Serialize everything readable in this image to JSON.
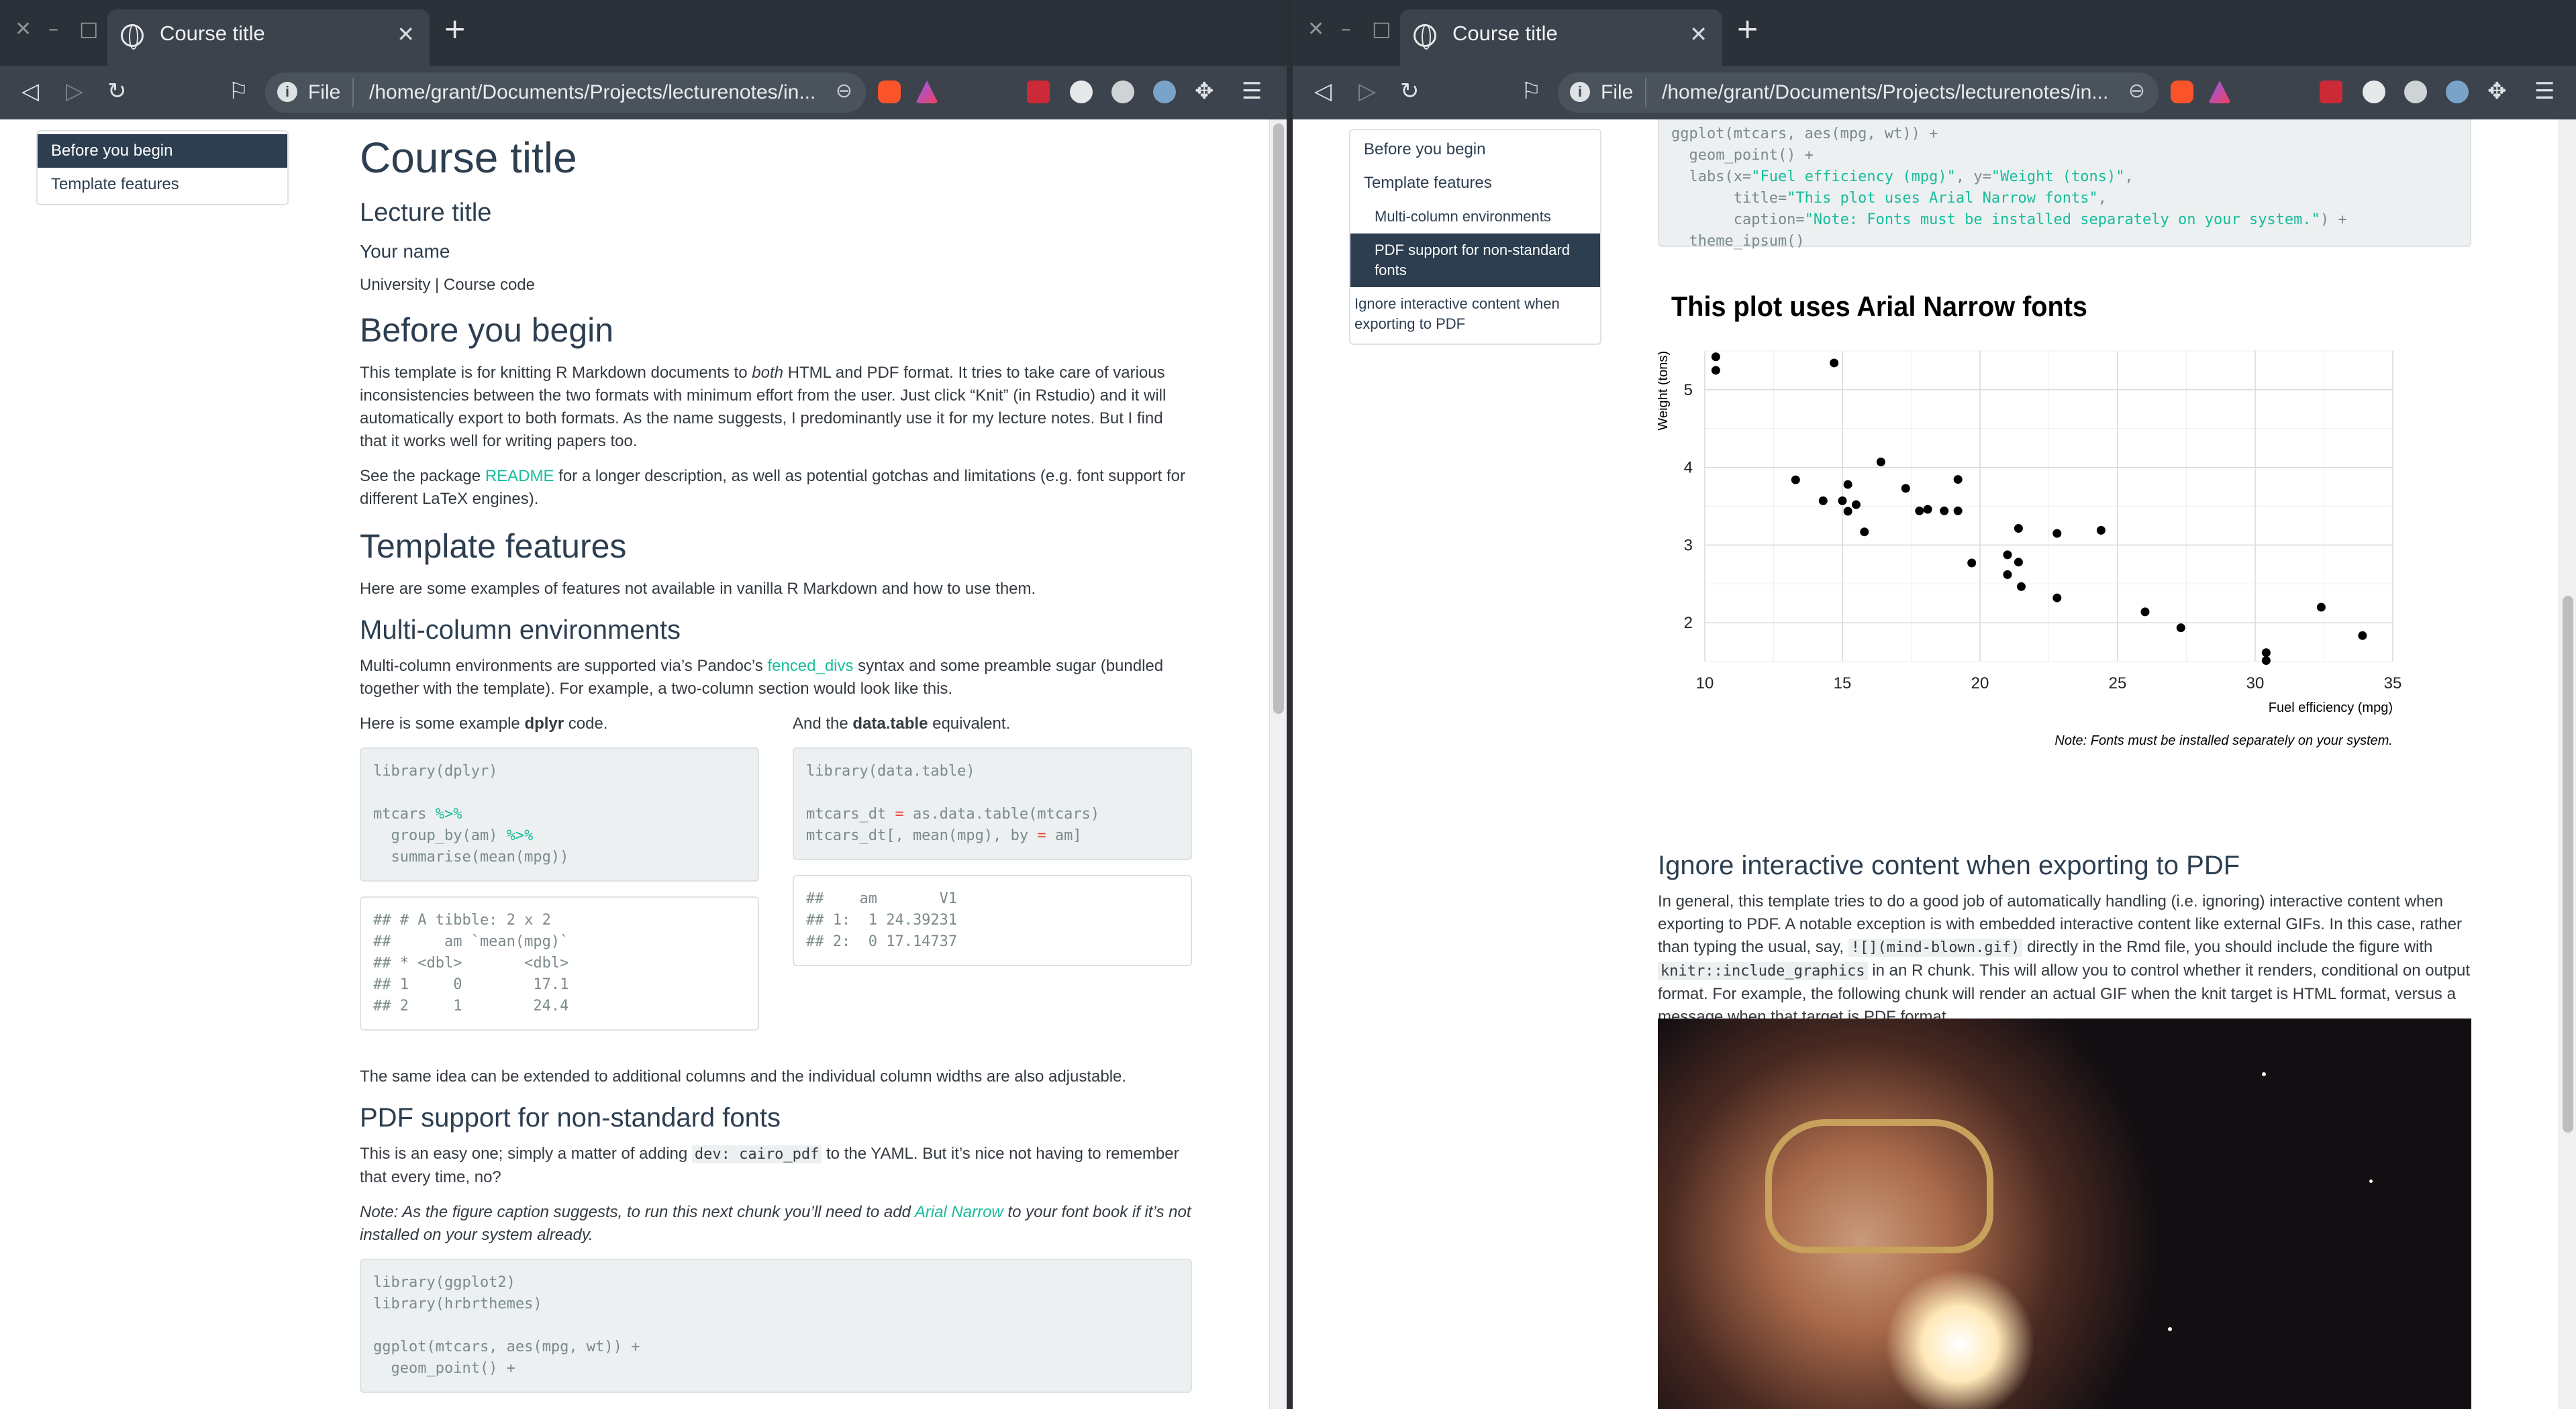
{
  "browser": {
    "tab_title": "Course title",
    "url_scheme": "File",
    "url_path": "/home/grant/Documents/Projects/lecturenotes/in..."
  },
  "toc": {
    "items": [
      "Before you begin",
      "Template features"
    ],
    "subitems": [
      "Multi-column environments",
      "PDF support for non-standard fonts",
      "Ignore interactive content when exporting to PDF"
    ]
  },
  "doc": {
    "title": "Course title",
    "subtitle": "Lecture title",
    "author": "Your name",
    "affil": "University | Course code",
    "s1": {
      "h": "Before you begin",
      "p1a": "This template is for knitting R Markdown documents to ",
      "p1b": "both",
      "p1c": " HTML and PDF format. It tries to take care of various inconsistencies between the two formats with minimum effort from the user. Just click “Knit” (in Rstudio) and it will automatically export to both formats. As the name suggests, I predominantly use it for my lecture notes. But I find that it works well for writing papers too.",
      "p2a": "See the package ",
      "p2link": "README",
      "p2b": " for a longer description, as well as potential gotchas and limitations (e.g. font support for different LaTeX engines)."
    },
    "s2": {
      "h": "Template features",
      "p": "Here are some examples of features not available in vanilla R Markdown and how to use them."
    },
    "s3": {
      "h": "Multi-column environments",
      "pa": "Multi-column environments are supported via’s Pandoc’s ",
      "plink": "fenced_divs",
      "pb": " syntax and some preamble sugar (bundled together with the template). For example, a two-column section would look like this.",
      "left_a": "Here is some example ",
      "left_b": "dplyr",
      "left_c": " code.",
      "right_a": "And the ",
      "right_b": "data.table",
      "right_c": " equivalent.",
      "code_l1": "library(dplyr)",
      "code_l2": "mtcars ",
      "code_l3": "  group_by(am) ",
      "code_l4": "  summarise(mean(mpg))",
      "pipe": "%>%",
      "out_l": [
        "## # A tibble: 2 x 2",
        "##      am `mean(mpg)`",
        "## * <dbl>       <dbl>",
        "## 1     0        17.1",
        "## 2     1        24.4"
      ],
      "code_r1": "library(data.table)",
      "code_r2a": "mtcars_dt ",
      "code_r2op": "=",
      "code_r2b": " as.data.table(mtcars)",
      "code_r3a": "mtcars_dt[, mean(mpg), by ",
      "code_r3b": " am]",
      "out_r": [
        "##    am       V1",
        "## 1:  1 24.39231",
        "## 2:  0 17.14737"
      ],
      "p_after": "The same idea can be extended to additional columns and the individual column widths are also adjustable."
    },
    "s4": {
      "h": "PDF support for non-standard fonts",
      "pa": "This is an easy one; simply a matter of adding ",
      "pcode": "dev: cairo_pdf",
      "pb": " to the YAML. But it’s nice not having to remember that every time, no?",
      "na": "Note: As the figure caption suggests, to run this next chunk you’ll need to add ",
      "nlink": "Arial Narrow",
      "nb": " to your font book if it’s not installed on your system already.",
      "code_a": [
        "library(ggplot2)",
        "library(hrbrthemes)",
        "",
        "ggplot(mtcars, aes(mpg, wt)) +",
        "  geom_point() +"
      ]
    },
    "right_code": {
      "l1": "ggplot(mtcars, aes(mpg, wt)) +",
      "l2": "  geom_point() +",
      "l3a": "  labs(x=",
      "l3s1": "\"Fuel efficiency (mpg)\"",
      "l3b": ", y=",
      "l3s2": "\"Weight (tons)\"",
      "l3c": ",",
      "l4a": "       title=",
      "l4s": "\"This plot uses Arial Narrow fonts\"",
      "l4b": ",",
      "l5a": "       caption=",
      "l5s": "\"Note: Fonts must be installed separately on your system.\"",
      "l5b": ") +",
      "l6": "  theme_ipsum()"
    },
    "s5": {
      "h": "Ignore interactive content when exporting to PDF",
      "pa": "In general, this template tries to do a good job of automatically handling (i.e. ignoring) interactive content when exporting to PDF. A notable exception is with embedded interactive content like external GIFs. In this case, rather than typing the usual, say, ",
      "pcode1": "![](mind-blown.gif)",
      "pb": " directly in the Rmd file, you should include the figure with ",
      "pcode2": "knitr::include_graphics",
      "pc": " in an R chunk. This will allow you to control whether it renders, conditional on output format. For example, the following chunk will render an actual GIF when the knit target is HTML format, versus a message when that target is PDF format."
    }
  },
  "chart_data": {
    "type": "scatter",
    "title": "This plot uses Arial Narrow fonts",
    "xlabel": "Fuel efficiency (mpg)",
    "ylabel": "Weight (tons)",
    "caption": "Note: Fonts must be installed separately on your system.",
    "xlim": [
      10,
      35
    ],
    "ylim": [
      1.5,
      5.5
    ],
    "xticks": [
      10,
      15,
      20,
      25,
      30,
      35
    ],
    "yticks": [
      2,
      3,
      4,
      5
    ],
    "grid": true,
    "x": [
      21,
      21,
      22.8,
      21.4,
      18.7,
      18.1,
      14.3,
      24.4,
      22.8,
      19.2,
      17.8,
      16.4,
      17.3,
      15.2,
      10.4,
      10.4,
      14.7,
      32.4,
      30.4,
      33.9,
      21.5,
      15.5,
      15.2,
      13.3,
      19.2,
      27.3,
      26,
      30.4,
      15.8,
      19.7,
      15,
      21.4
    ],
    "y": [
      2.62,
      2.875,
      2.32,
      3.215,
      3.44,
      3.46,
      3.57,
      3.19,
      3.15,
      3.44,
      3.44,
      4.07,
      3.73,
      3.78,
      5.25,
      5.424,
      5.345,
      2.2,
      1.615,
      1.835,
      2.465,
      3.52,
      3.435,
      3.84,
      3.845,
      1.935,
      2.14,
      1.513,
      3.17,
      2.77,
      3.57,
      2.78
    ]
  }
}
